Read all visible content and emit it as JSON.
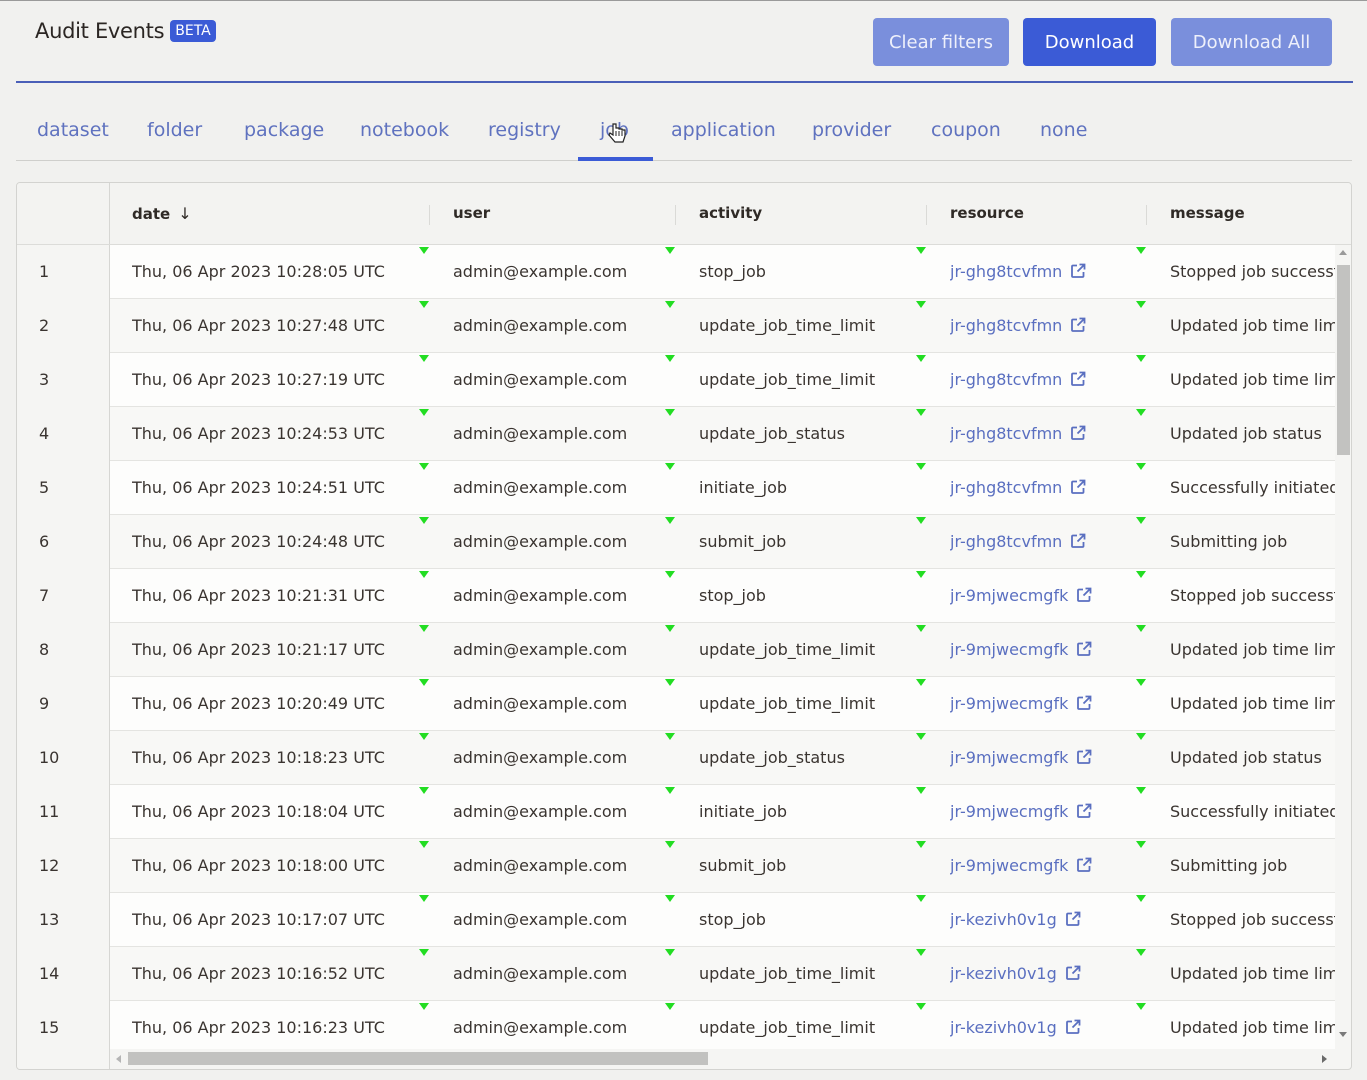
{
  "header": {
    "title": "Audit Events",
    "badge": "BETA",
    "buttons": {
      "clear_filters": "Clear filters",
      "download": "Download",
      "download_all": "Download All"
    }
  },
  "tabs": [
    {
      "label": "dataset",
      "active": false
    },
    {
      "label": "folder",
      "active": false
    },
    {
      "label": "package",
      "active": false
    },
    {
      "label": "notebook",
      "active": false
    },
    {
      "label": "registry",
      "active": false
    },
    {
      "label": "job",
      "active": true
    },
    {
      "label": "application",
      "active": false
    },
    {
      "label": "provider",
      "active": false
    },
    {
      "label": "coupon",
      "active": false
    },
    {
      "label": "none",
      "active": false
    }
  ],
  "table": {
    "columns": {
      "date": "date",
      "date_sort": "↓",
      "user": "user",
      "activity": "activity",
      "resource": "resource",
      "message": "message"
    },
    "rows": [
      {
        "idx": "1",
        "date": "Thu, 06 Apr 2023 10:28:05 UTC",
        "user": "admin@example.com",
        "activity": "stop_job",
        "resource": "jr-ghg8tcvfmn",
        "message": "Stopped job successfully"
      },
      {
        "idx": "2",
        "date": "Thu, 06 Apr 2023 10:27:48 UTC",
        "user": "admin@example.com",
        "activity": "update_job_time_limit",
        "resource": "jr-ghg8tcvfmn",
        "message": "Updated job time limit"
      },
      {
        "idx": "3",
        "date": "Thu, 06 Apr 2023 10:27:19 UTC",
        "user": "admin@example.com",
        "activity": "update_job_time_limit",
        "resource": "jr-ghg8tcvfmn",
        "message": "Updated job time limit"
      },
      {
        "idx": "4",
        "date": "Thu, 06 Apr 2023 10:24:53 UTC",
        "user": "admin@example.com",
        "activity": "update_job_status",
        "resource": "jr-ghg8tcvfmn",
        "message": "Updated job status"
      },
      {
        "idx": "5",
        "date": "Thu, 06 Apr 2023 10:24:51 UTC",
        "user": "admin@example.com",
        "activity": "initiate_job",
        "resource": "jr-ghg8tcvfmn",
        "message": "Successfully initiated"
      },
      {
        "idx": "6",
        "date": "Thu, 06 Apr 2023 10:24:48 UTC",
        "user": "admin@example.com",
        "activity": "submit_job",
        "resource": "jr-ghg8tcvfmn",
        "message": "Submitting job"
      },
      {
        "idx": "7",
        "date": "Thu, 06 Apr 2023 10:21:31 UTC",
        "user": "admin@example.com",
        "activity": "stop_job",
        "resource": "jr-9mjwecmgfk",
        "message": "Stopped job successfully"
      },
      {
        "idx": "8",
        "date": "Thu, 06 Apr 2023 10:21:17 UTC",
        "user": "admin@example.com",
        "activity": "update_job_time_limit",
        "resource": "jr-9mjwecmgfk",
        "message": "Updated job time limit"
      },
      {
        "idx": "9",
        "date": "Thu, 06 Apr 2023 10:20:49 UTC",
        "user": "admin@example.com",
        "activity": "update_job_time_limit",
        "resource": "jr-9mjwecmgfk",
        "message": "Updated job time limit"
      },
      {
        "idx": "10",
        "date": "Thu, 06 Apr 2023 10:18:23 UTC",
        "user": "admin@example.com",
        "activity": "update_job_status",
        "resource": "jr-9mjwecmgfk",
        "message": "Updated job status"
      },
      {
        "idx": "11",
        "date": "Thu, 06 Apr 2023 10:18:04 UTC",
        "user": "admin@example.com",
        "activity": "initiate_job",
        "resource": "jr-9mjwecmgfk",
        "message": "Successfully initiated"
      },
      {
        "idx": "12",
        "date": "Thu, 06 Apr 2023 10:18:00 UTC",
        "user": "admin@example.com",
        "activity": "submit_job",
        "resource": "jr-9mjwecmgfk",
        "message": "Submitting job"
      },
      {
        "idx": "13",
        "date": "Thu, 06 Apr 2023 10:17:07 UTC",
        "user": "admin@example.com",
        "activity": "stop_job",
        "resource": "jr-kezivh0v1g",
        "message": "Stopped job successfully"
      },
      {
        "idx": "14",
        "date": "Thu, 06 Apr 2023 10:16:52 UTC",
        "user": "admin@example.com",
        "activity": "update_job_time_limit",
        "resource": "jr-kezivh0v1g",
        "message": "Updated job time limit"
      },
      {
        "idx": "15",
        "date": "Thu, 06 Apr 2023 10:16:23 UTC",
        "user": "admin@example.com",
        "activity": "update_job_time_limit",
        "resource": "jr-kezivh0v1g",
        "message": "Updated job time limit"
      }
    ]
  },
  "colors": {
    "accent": "#3b5bd6",
    "link": "#5a6fc0",
    "marker": "#22dd22"
  }
}
